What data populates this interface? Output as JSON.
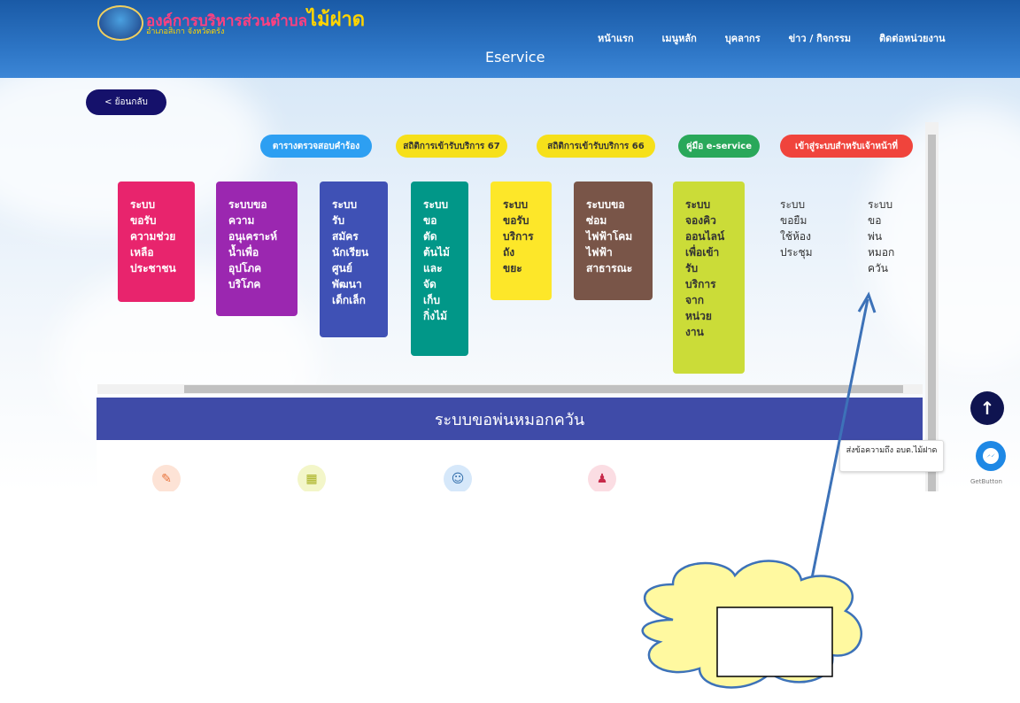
{
  "header": {
    "org_name_prefix": "องค์การบริหารส่วนตำบล",
    "org_name_highlight": "ไม้ฝาด",
    "org_subtitle": "อำเภอสิเกา จังหวัดตรัง",
    "nav": [
      "หน้าแรก",
      "เมนูหลัก",
      "บุคลากร",
      "ข่าว / กิจกรรม",
      "ติดต่อหน่วยงาน"
    ],
    "page_title": "Eservice"
  },
  "back_label": "< ย้อนกลับ",
  "pills": [
    {
      "label": "ตารางตรวจสอบคำร้อง",
      "color": "#2d9ff2",
      "text_color": "#ffffff"
    },
    {
      "label": "สถิติการเข้ารับบริการ 67",
      "color": "#f6e01a",
      "text_color": "#333333"
    },
    {
      "label": "สถิติการเข้ารับบริการ 66",
      "color": "#f6e01a",
      "text_color": "#333333"
    },
    {
      "label": "คู่มือ e-service",
      "color": "#29a85a",
      "text_color": "#ffffff"
    },
    {
      "label": "เข้าสู่ระบบสำหรับเจ้าหน้าที่",
      "color": "#f0443c",
      "text_color": "#ffffff"
    }
  ],
  "services": [
    {
      "lines": [
        "ระบบ",
        "ขอรับ",
        "ความช่วย",
        "เหลือ",
        "ประชาชน"
      ],
      "color": "#e8246d"
    },
    {
      "lines": [
        "ระบบขอ",
        "ความ",
        "อนุเคราะห์",
        "น้ำเพื่อ",
        "อุปโภค",
        "บริโภค"
      ],
      "color": "#9b27b0"
    },
    {
      "lines": [
        "ระบบ",
        "รับ",
        "สมัคร",
        "นักเรียน",
        "ศูนย์",
        "พัฒนา",
        "เด็กเล็ก"
      ],
      "color": "#3f51b5"
    },
    {
      "lines": [
        "ระบบ",
        "ขอ",
        "ตัด",
        "ต้นไม้",
        "และ",
        "จัด",
        "เก็บ",
        "กิ่งไม้"
      ],
      "color": "#019788"
    },
    {
      "lines": [
        "ระบบ",
        "ขอรับ",
        "บริการ",
        "ถัง",
        "ขยะ"
      ],
      "color": "#fde729"
    },
    {
      "lines": [
        "ระบบขอ",
        "ซ่อม",
        "ไฟฟ้าโคม",
        "ไฟฟ้า",
        "สาธารณะ"
      ],
      "color": "#795548"
    },
    {
      "lines": [
        "ระบบ",
        "จองคิว",
        "ออนไลน์",
        "เพื่อเข้า",
        "รับ",
        "บริการ",
        "จาก",
        "หน่วย",
        "งาน"
      ],
      "color": "#cbdc38"
    },
    {
      "lines": [
        "ระบบ",
        "ขอยืม",
        "ใช้ห้อง",
        "ประชุม"
      ],
      "color": "transparent"
    },
    {
      "lines": [
        "ระบบ",
        "ขอ",
        "พ่น",
        "หมอก",
        "ควัน"
      ],
      "color": "transparent"
    }
  ],
  "banner_title": "ระบบขอพ่นหมอกควัน",
  "feature_icons": [
    "form-icon",
    "flowchart-icon",
    "officer-icon",
    "user-check-icon"
  ],
  "tooltip_text": "ส่งข้อความถึง อบต.ไม้ฝาด",
  "getbutton_label": "GetButton",
  "scroll_arrow_up": "↑"
}
